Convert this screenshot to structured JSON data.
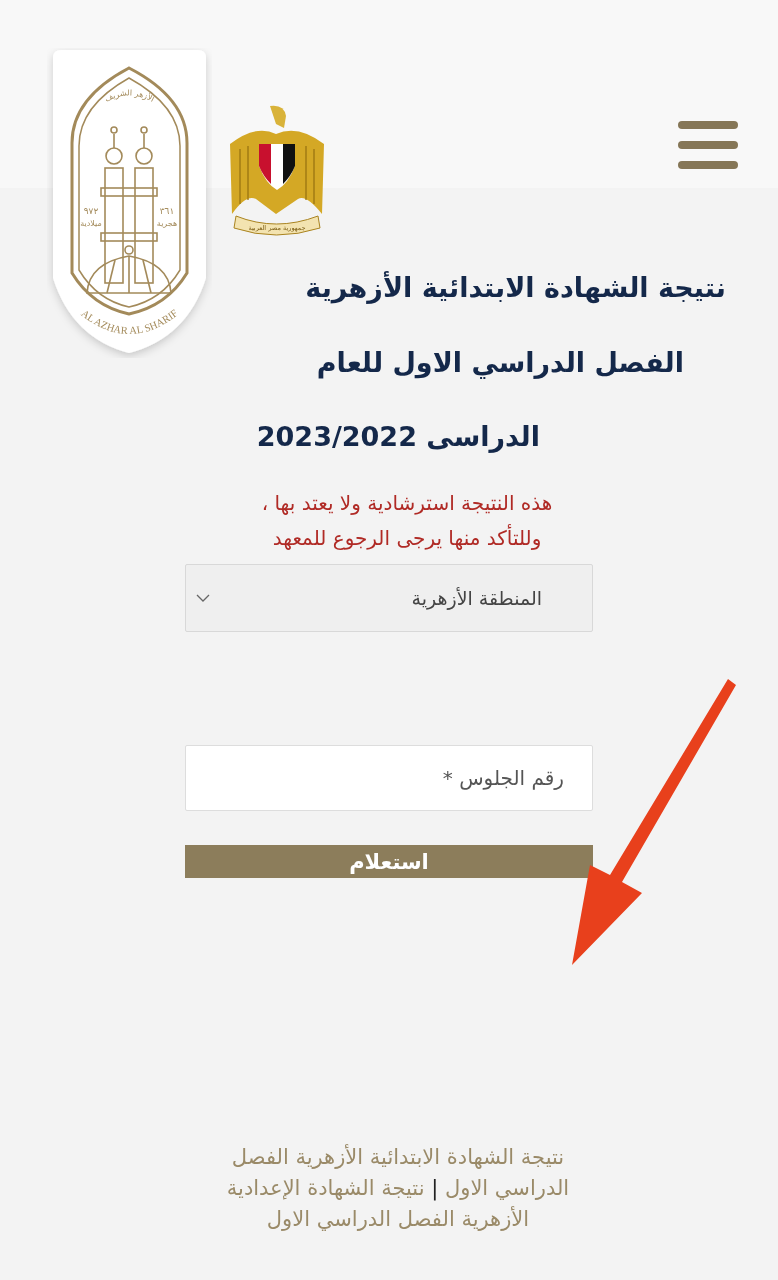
{
  "header": {
    "logo": {
      "top_text": "الأزهر الشريف",
      "caption": "AL AZHAR AL SHARIF",
      "year_hijri": "٣٦١",
      "hijri_label": "هجرية",
      "year_gregorian": "٩٧٢",
      "gregorian_label": "ميلادية"
    },
    "emblem": {
      "scroll_text": "جمهورية مصر العربية"
    }
  },
  "title_lines": [
    "نتيجة الشهادة الابتدائية الأزهرية",
    "الفصل الدراسي الاول للعام",
    "الدراسى 2023/2022"
  ],
  "notice_lines": [
    "هذه النتيجة استرشادية ولا يعتد بها ،",
    "وللتأكد منها يرجى الرجوع للمعهد"
  ],
  "form": {
    "region_select": {
      "value": "المنطقة الأزهرية"
    },
    "seat_number": {
      "placeholder": "رقم الجلوس *"
    },
    "submit": "استعلام"
  },
  "footer": {
    "links": [
      "نتيجة الشهادة الابتدائية الأزهرية الفصل الدراسي الاول",
      "نتيجة الشهادة الإعدادية الأزهرية الفصل الدراسي الاول"
    ],
    "separator": "|"
  }
}
